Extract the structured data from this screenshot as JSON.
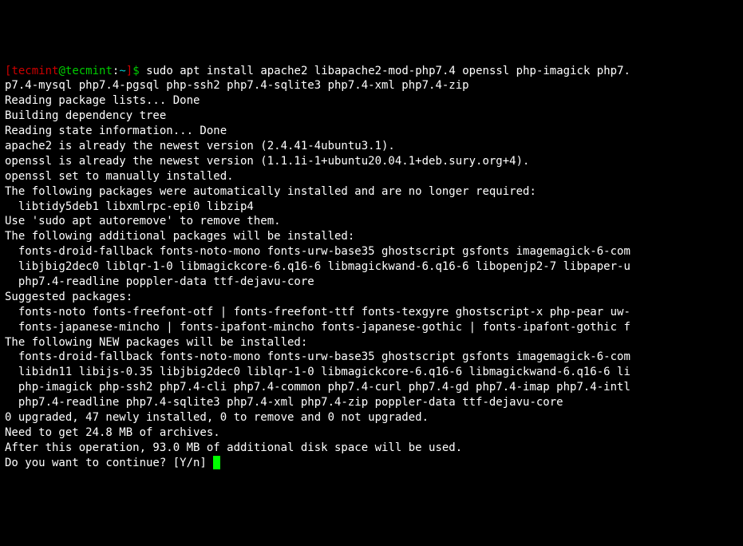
{
  "prompt": {
    "open_bracket": "[",
    "user": "tecmint",
    "at": "@",
    "host": "tecmint",
    "colon": ":",
    "path": "~",
    "close_bracket": "]",
    "dollar": "$ "
  },
  "command": "sudo apt install apache2 libapache2-mod-php7.4 openssl php-imagick php7.",
  "command2": "p7.4-mysql php7.4-pgsql php-ssh2 php7.4-sqlite3 php7.4-xml php7.4-zip",
  "lines": {
    "l1": "Reading package lists... Done",
    "l2": "Building dependency tree",
    "l3": "Reading state information... Done",
    "l4": "apache2 is already the newest version (2.4.41-4ubuntu3.1).",
    "l5": "openssl is already the newest version (1.1.1i-1+ubuntu20.04.1+deb.sury.org+4).",
    "l6": "openssl set to manually installed.",
    "l7": "The following packages were automatically installed and are no longer required:",
    "l8": "  libtidy5deb1 libxmlrpc-epi0 libzip4",
    "l9": "Use 'sudo apt autoremove' to remove them.",
    "l10": "The following additional packages will be installed:",
    "l11": "  fonts-droid-fallback fonts-noto-mono fonts-urw-base35 ghostscript gsfonts imagemagick-6-com",
    "l12": "  libjbig2dec0 liblqr-1-0 libmagickcore-6.q16-6 libmagickwand-6.q16-6 libopenjp2-7 libpaper-u",
    "l13": "  php7.4-readline poppler-data ttf-dejavu-core",
    "l14": "Suggested packages:",
    "l15": "  fonts-noto fonts-freefont-otf | fonts-freefont-ttf fonts-texgyre ghostscript-x php-pear uw-",
    "l16": "  fonts-japanese-mincho | fonts-ipafont-mincho fonts-japanese-gothic | fonts-ipafont-gothic f",
    "l17": "The following NEW packages will be installed:",
    "l18": "  fonts-droid-fallback fonts-noto-mono fonts-urw-base35 ghostscript gsfonts imagemagick-6-com",
    "l19": "  libidn11 libijs-0.35 libjbig2dec0 liblqr-1-0 libmagickcore-6.q16-6 libmagickwand-6.q16-6 li",
    "l20": "  php-imagick php-ssh2 php7.4-cli php7.4-common php7.4-curl php7.4-gd php7.4-imap php7.4-intl",
    "l21": "  php7.4-readline php7.4-sqlite3 php7.4-xml php7.4-zip poppler-data ttf-dejavu-core",
    "l22": "0 upgraded, 47 newly installed, 0 to remove and 0 not upgraded.",
    "l23": "Need to get 24.8 MB of archives.",
    "l24": "After this operation, 93.0 MB of additional disk space will be used.",
    "l25": "Do you want to continue? [Y/n] "
  }
}
